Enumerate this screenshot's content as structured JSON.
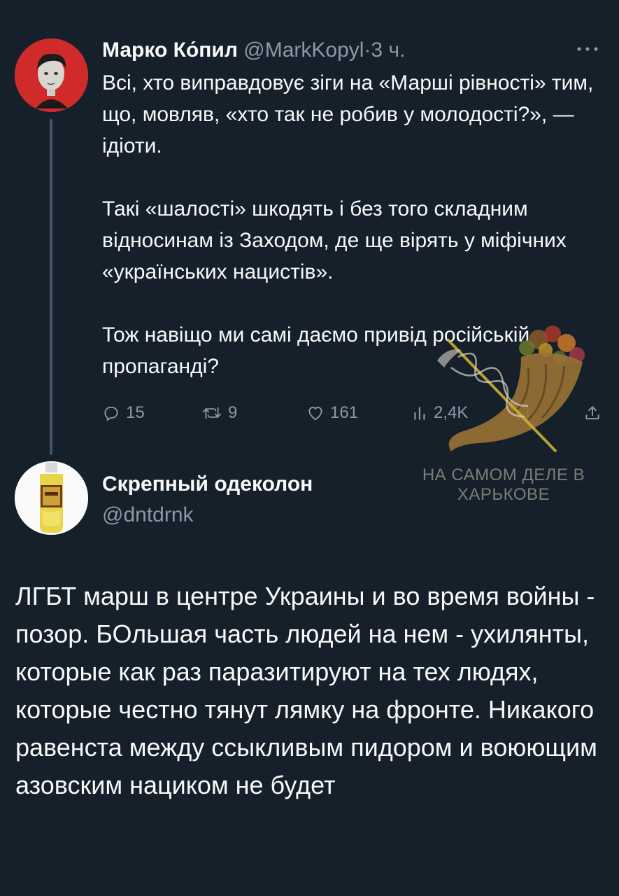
{
  "tweet_1": {
    "display_name": "Марко Ко́пил",
    "handle": "@MarkKopyl",
    "separator": "·",
    "time": "3 ч.",
    "more_icon": "more-horizontal-icon",
    "paragraphs": [
      "Всі, хто виправдовує зіги на «Марші рівності» тим, що, мовляв, «хто так не робив у молодості?», — ідіоти.",
      "Такі «шалості» шкодять і без того складним відносинам із Заходом, де ще вірять у міфічних «українських нацистів».",
      "Тож навіщо ми самі даємо привід російській пропаганді?"
    ],
    "actions": {
      "reply_icon": "reply-icon",
      "reply_count": "15",
      "retweet_icon": "retweet-icon",
      "retweet_count": "9",
      "like_icon": "heart-icon",
      "like_count": "161",
      "views_icon": "views-icon",
      "views_count": "2,4K",
      "bookmark_icon": "bookmark-icon",
      "share_icon": "share-icon"
    }
  },
  "tweet_2": {
    "display_name": "Скрепный одеколон",
    "handle": "@dntdrnk",
    "text": "ЛГБТ марш в центре Украины и во время войны - позор. БОльшая часть людей на нем - ухилянты, которые как раз паразитируют на тех людях, которые честно тянут лямку на фронте. Никакого равенста между ссыкливым пидором и воюющим азовским нациком не будет"
  },
  "watermark": {
    "text": "НА САМОМ ДЕЛЕ В ХАРЬКОВЕ"
  },
  "colors": {
    "background": "#15202b",
    "primary_text": "#f7f9f9",
    "secondary_text": "#8b98a5",
    "thread_line": "#425466",
    "avatar_1_bg": "#cf2b2b"
  }
}
